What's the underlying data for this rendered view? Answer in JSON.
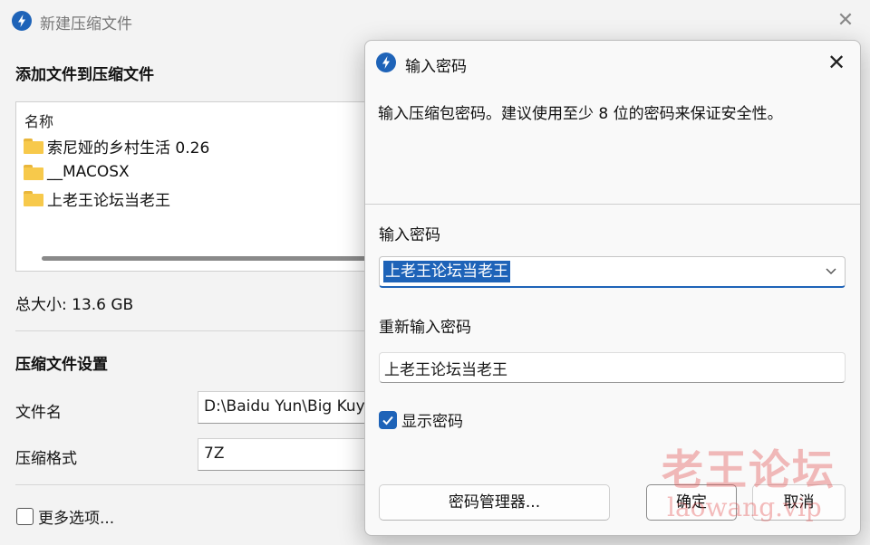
{
  "background_window": {
    "title": "新建压缩文件",
    "add_files_heading": "添加文件到压缩文件",
    "column_name": "名称",
    "files": [
      {
        "name": "索尼娅的乡村生活 0.26",
        "icon": "folder-icon"
      },
      {
        "name": "__MACOSX",
        "icon": "folder-icon"
      },
      {
        "name": "上老王论坛当老王",
        "icon": "folder-icon"
      }
    ],
    "total_size": "总大小: 13.6 GB",
    "settings_heading": "压缩文件设置",
    "filename_label": "文件名",
    "filename_value": "D:\\Baidu Yun\\Big Kuy",
    "format_label": "压缩格式",
    "format_value": "7Z",
    "more_options_label": "更多选项..."
  },
  "dialog": {
    "title": "输入密码",
    "description": "输入压缩包密码。建议使用至少 8 位的密码来保证安全性。",
    "password_label": "输入密码",
    "password_value": "上老王论坛当老王",
    "reenter_label": "重新输入密码",
    "reenter_value": "上老王论坛当老王",
    "show_password_label": "显示密码",
    "show_password_checked": true,
    "password_manager_button": "密码管理器...",
    "ok_button": "确定",
    "cancel_button": "取消"
  },
  "watermark": {
    "text_cn": "老王论坛",
    "text_en": "laowang.vip"
  },
  "colors": {
    "accent": "#1e63b8",
    "folder": "#f7c94b",
    "watermark": "#e15050"
  }
}
